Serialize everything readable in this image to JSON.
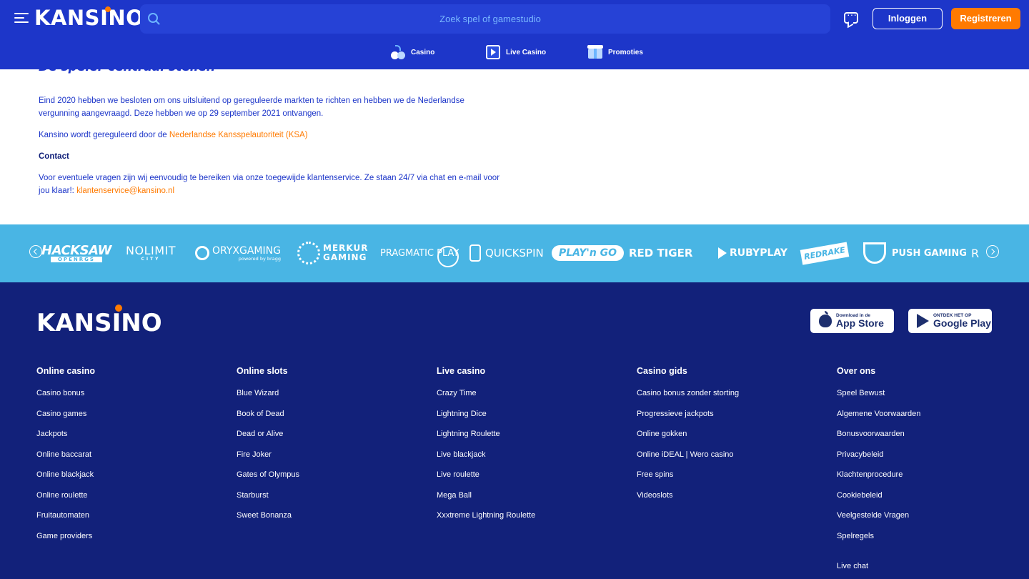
{
  "header": {
    "logo": "KANSINO",
    "search_placeholder": "Zoek spel of gamestudio",
    "login_label": "Inloggen",
    "register_label": "Registreren",
    "nav": [
      {
        "label": "Casino",
        "icon": "cherries-icon"
      },
      {
        "label": "Live Casino",
        "icon": "live-play-icon"
      },
      {
        "label": "Promoties",
        "icon": "gift-icon"
      }
    ]
  },
  "content": {
    "title": "De speler centraal stellen",
    "p1": "Eind 2020 hebben we besloten om ons uitsluitend op gereguleerde markten te richten en hebben we de Nederlandse vergunning aangevraagd. Deze hebben we op 29 september 2021 ontvangen.",
    "p2_text": "Kansino wordt gereguleerd door de ",
    "p2_link": "Nederlandse Kansspelautoriteit (KSA)",
    "p3": "Contact",
    "p4_text": "Voor eventuele vragen zijn wij eenvoudig te bereiken via onze toegewijde klantenservice. Ze staan 24/7 via chat en e-mail voor jou klaar!: ",
    "p4_link": "klantenservice@kansino.nl"
  },
  "providers": [
    "HACKSAW",
    "OPENRGS",
    "NOLIMIT",
    "CITY",
    "ORYXGAMING",
    "powered by bragg",
    "MERKUR",
    "GAMING",
    "PRAGMATIC PLAY",
    "QUICKSPIN",
    "PLAY'n GO",
    "RED TIGER",
    "RUBYPLAY",
    "REDRAKE",
    "PUSH GAMING",
    "R"
  ],
  "footer": {
    "logo": "KANSINO",
    "appstore_small": "Download in de",
    "appstore_big": "App Store",
    "gplay_small": "ONTDEK HET OP",
    "gplay_big": "Google Play",
    "columns": [
      {
        "title": "Online casino",
        "links": [
          "Casino bonus",
          "Casino games",
          "Jackpots",
          "Online baccarat",
          "Online blackjack",
          "Online roulette",
          "Fruitautomaten",
          "Game providers"
        ]
      },
      {
        "title": "Online slots",
        "links": [
          "Blue Wizard",
          "Book of Dead",
          "Dead or Alive",
          "Fire Joker",
          "Gates of Olympus",
          "Starburst",
          "Sweet Bonanza"
        ]
      },
      {
        "title": "Live casino",
        "links": [
          "Crazy Time",
          "Lightning Dice",
          "Lightning Roulette",
          "Live blackjack",
          "Live roulette",
          "Mega Ball",
          "Xxxtreme Lightning Roulette"
        ]
      },
      {
        "title": "Casino gids",
        "links": [
          "Casino bonus zonder storting",
          "Progressieve jackpots",
          "Online gokken",
          "Online iDEAL | Wero casino",
          "Free spins",
          "Videoslots"
        ]
      },
      {
        "title": "Over ons",
        "links": [
          "Speel Bewust",
          "Algemene Voorwaarden",
          "Bonusvoorwaarden",
          "Privacybeleid",
          "Klachtenprocedure",
          "Cookiebeleid",
          "Veelgestelde Vragen",
          "Spelregels"
        ]
      }
    ],
    "live_chat": "Live chat"
  },
  "colors": {
    "header_bg": "#1d36c9",
    "footer_bg": "#12217a",
    "providers_bg": "#49b5e4",
    "accent": "#ff7a00"
  }
}
